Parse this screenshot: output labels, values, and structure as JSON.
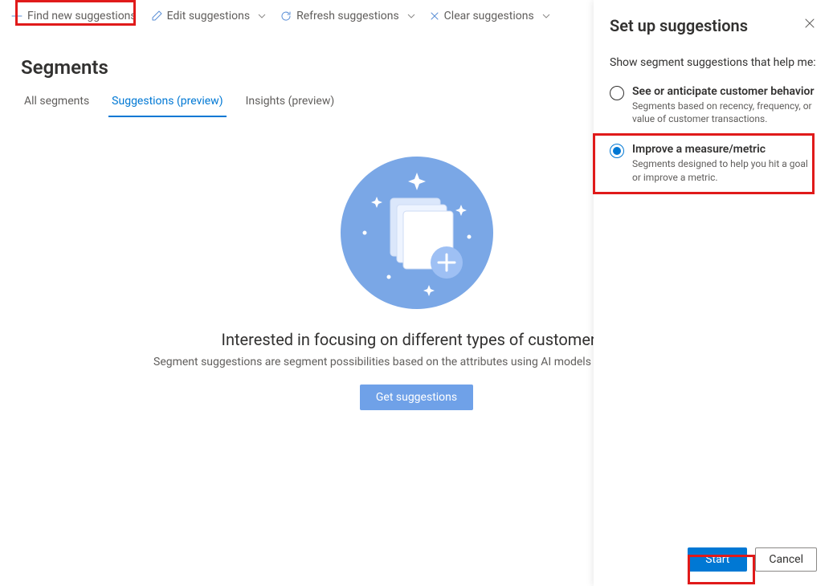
{
  "toolbar": {
    "find": "Find new suggestions",
    "edit": "Edit suggestions",
    "refresh": "Refresh suggestions",
    "clear": "Clear suggestions"
  },
  "page": {
    "title": "Segments"
  },
  "tabs": {
    "all": "All segments",
    "suggestions": "Suggestions (preview)",
    "insights": "Insights (preview)"
  },
  "empty": {
    "heading": "Interested in focusing on different types of customers?",
    "description": "Segment suggestions are segment possibilities based on the attributes using AI models or based on activ",
    "button": "Get suggestions"
  },
  "panel": {
    "title": "Set up suggestions",
    "prompt": "Show segment suggestions that help me:",
    "options": {
      "behavior": {
        "label": "See or anticipate customer behavior",
        "desc": "Segments based on recency, frequency, or value of customer transactions."
      },
      "measure": {
        "label": "Improve a measure/metric",
        "desc": "Segments designed to help you hit a goal or improve a metric."
      }
    },
    "footer": {
      "start": "Start",
      "cancel": "Cancel"
    }
  }
}
